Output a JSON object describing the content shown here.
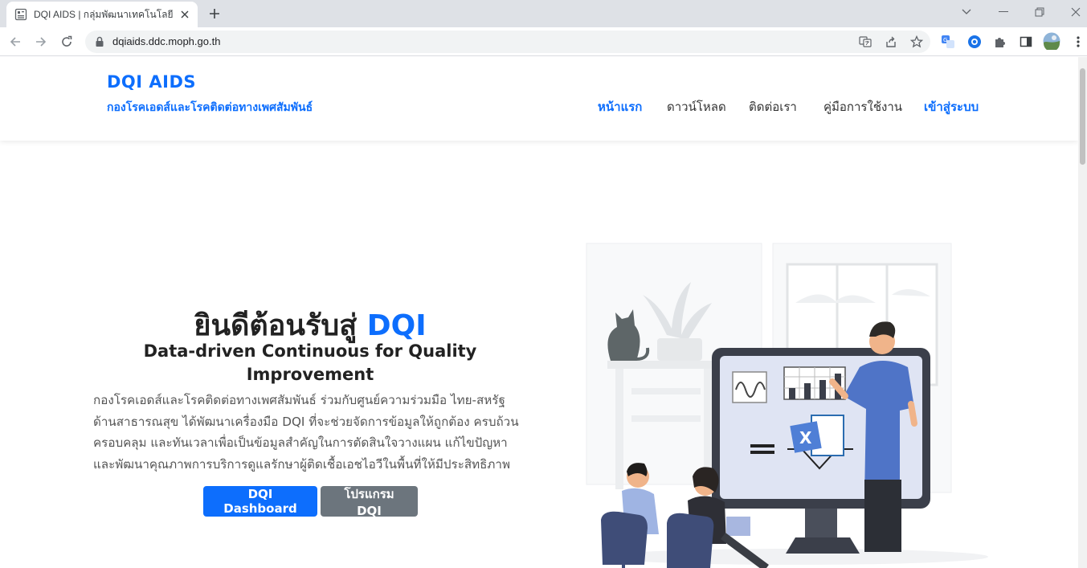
{
  "browser": {
    "tab_title": "DQI AIDS | กลุ่มพัฒนาเทคโนโลยีและ",
    "url": "dqiaids.ddc.moph.go.th"
  },
  "site": {
    "brand_title": "DQI AIDS",
    "brand_subtitle": "กองโรคเอดส์และโรคติดต่อทางเพศสัมพันธ์",
    "nav": {
      "home": "หน้าแรก",
      "download": "ดาวน์โหลด",
      "contact": "ติดต่อเรา",
      "manual": "คู่มือการใช้งาน",
      "login": "เข้าสู่ระบบ"
    }
  },
  "hero": {
    "title_prefix": "ยินดีต้อนรับสู่",
    "title_accent": "DQI",
    "subtitle": "Data-driven Continuous for Quality Improvement",
    "description": "กองโรคเอดส์และโรคติดต่อทางเพศสัมพันธ์ ร่วมกับศูนย์ความร่วมมือ ไทย-สหรัฐ ด้านสาธารณสุข ได้พัฒนาเครื่องมือ DQI ที่จะช่วยจัดการข้อมูลให้ถูกต้อง ครบถ้วน ครอบคลุม และทันเวลาเพื่อเป็นข้อมูลสำคัญในการตัดสินใจวางแผน แก้ไขปัญหา และพัฒนาคุณภาพการบริการดูแลรักษาผู้ติดเชื้อเอชไอวีในพื้นที่ให้มีประสิทธิภาพ",
    "buttons": {
      "dashboard": "DQI Dashboard",
      "program": "โปรแกรม DQI"
    }
  },
  "colors": {
    "primary": "#0d6efd",
    "secondary": "#6c757d"
  },
  "icons": [
    "favicon-icon",
    "close-icon",
    "plus-icon",
    "chevron-down-icon",
    "minimize-icon",
    "restore-icon",
    "window-close-icon",
    "back-icon",
    "forward-icon",
    "reload-icon",
    "lock-icon",
    "translate-icon",
    "share-icon",
    "star-icon",
    "extension-translate-icon",
    "extension-edge-icon",
    "puzzle-icon",
    "sidepanel-icon",
    "profile-avatar",
    "kebab-menu-icon"
  ]
}
